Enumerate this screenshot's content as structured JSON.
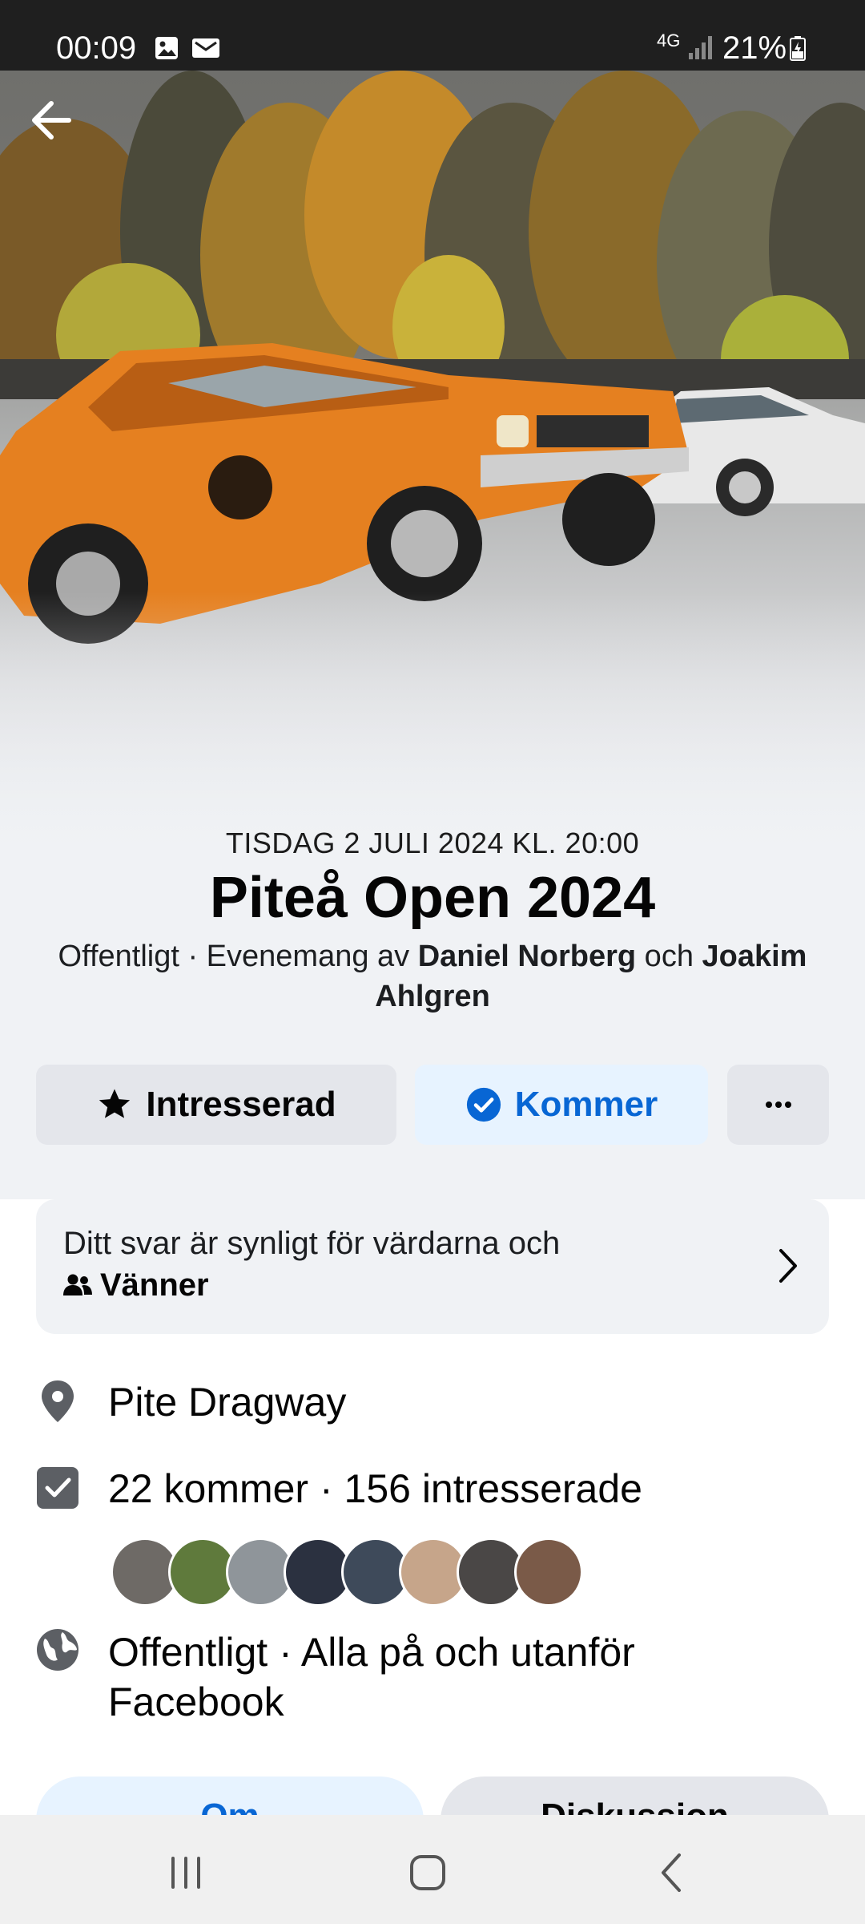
{
  "status_bar": {
    "time": "00:09",
    "network": "4G",
    "battery": "21%"
  },
  "event": {
    "date": "TISDAG 2 JULI 2024 KL. 20:00",
    "title": "Piteå Open 2024",
    "privacy_prefix": "Offentligt · Evenemang av ",
    "host1": "Daniel Norberg",
    "conjunction": " och ",
    "host2": "Joakim Ahlgren"
  },
  "actions": {
    "interested_label": "Intresserad",
    "going_label": "Kommer",
    "more_label": "···"
  },
  "visibility": {
    "line1": "Ditt svar är synligt för värdarna och",
    "line2": "Vänner"
  },
  "details": {
    "location": "Pite Dragway",
    "attendance": "22 kommer · 156 intresserade",
    "privacy_line1": "Offentligt · Alla på och utanför",
    "privacy_line2": "Facebook"
  },
  "tabs": {
    "about": "Om",
    "discussion": "Diskussion"
  },
  "colors": {
    "accent": "#0866d4",
    "accent_bg": "#e7f3ff",
    "button_gray": "#e4e6eb",
    "band_gray": "#f0f2f5"
  },
  "icons": [
    "back-arrow-icon",
    "star-icon",
    "check-circle-icon",
    "more-icon",
    "friends-icon",
    "chevron-right-icon",
    "location-pin-icon",
    "checkbox-icon",
    "globe-icon",
    "recent-apps-icon",
    "home-icon",
    "nav-back-icon"
  ]
}
